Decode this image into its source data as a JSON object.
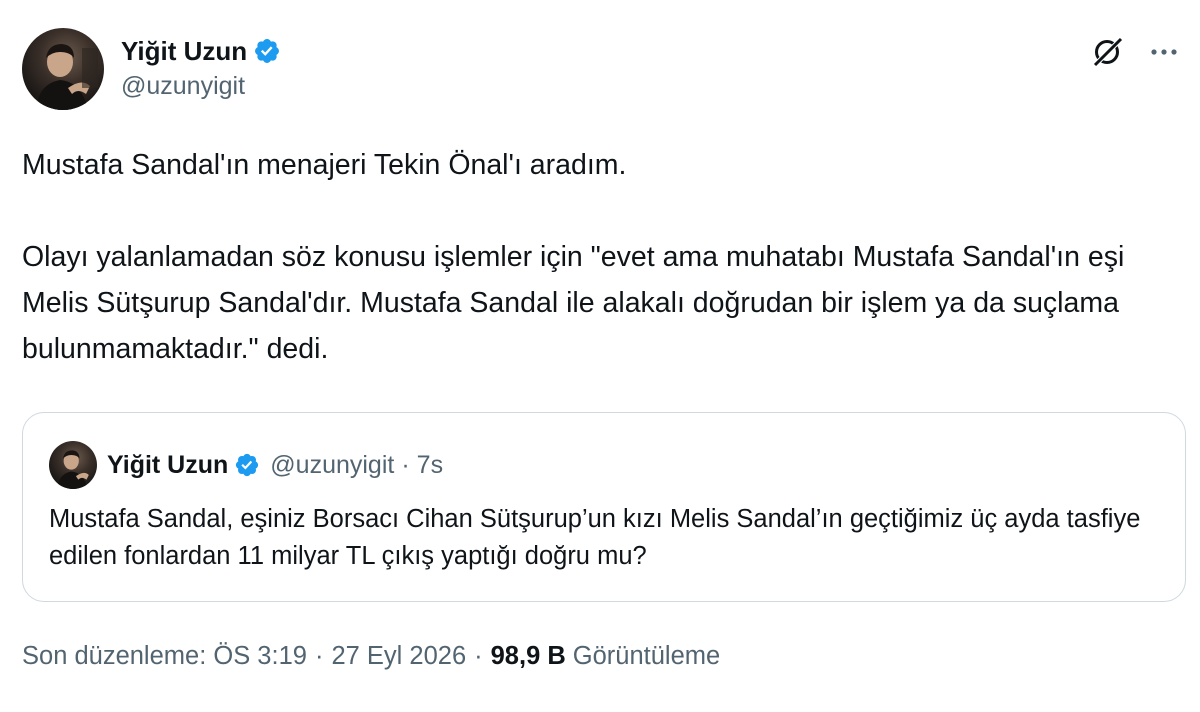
{
  "author": {
    "display_name": "Yiğit Uzun",
    "handle": "@uzunyigit"
  },
  "icons": {
    "verified": "verified-badge-icon",
    "grok": "grok-icon",
    "more": "more-options-icon"
  },
  "colors": {
    "verified_blue": "#1d9bf0",
    "secondary_text": "#536471",
    "primary_text": "#0f1419",
    "card_border": "#cfd9de"
  },
  "tweet": {
    "paragraph_1": "Mustafa Sandal'ın menajeri Tekin Önal'ı aradım.",
    "paragraph_2": "Olayı yalanlamadan söz konusu işlemler için \"evet ama muhatabı Mustafa Sandal'ın eşi Melis Sütşurup Sandal'dır. Mustafa Sandal ile alakalı doğrudan bir işlem ya da suçlama bulunmamaktadır.\" dedi."
  },
  "quoted_tweet": {
    "display_name": "Yiğit Uzun",
    "handle": "@uzunyigit",
    "separator": "·",
    "time": "7s",
    "text": "Mustafa Sandal, eşiniz Borsacı Cihan Sütşurup’un kızı Melis Sandal’ın geçtiğimiz üç ayda tasfiye edilen fonlardan 11 milyar TL çıkış yaptığı doğru mu?"
  },
  "meta": {
    "edited_label": "Son düzenleme: ÖS 3:19",
    "separator": "·",
    "date": "27 Eyl 2026",
    "separator_2": "·",
    "views_count": "98,9 B",
    "views_label": "Görüntüleme"
  }
}
